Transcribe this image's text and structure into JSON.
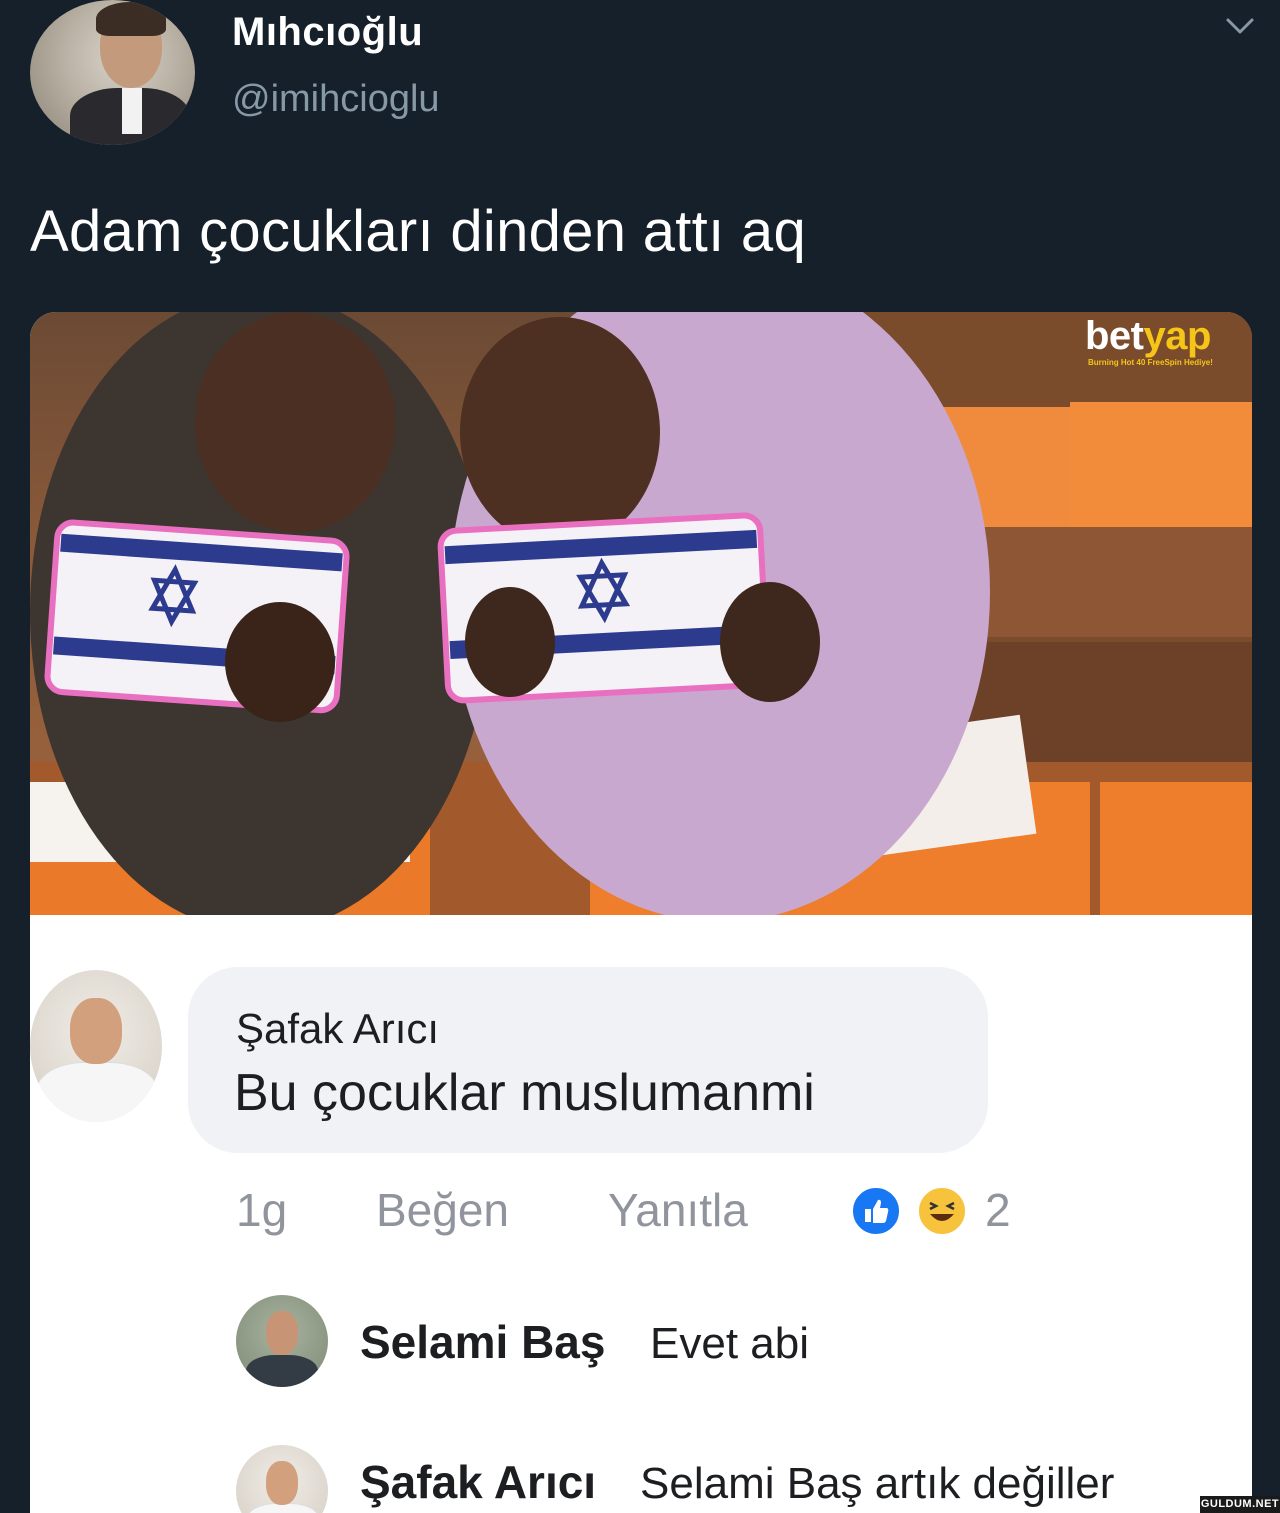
{
  "tweet": {
    "author_name": "Mıhcıoğlu",
    "author_handle": "@imihcioglu",
    "text": "Adam çocukları dinden attı aq"
  },
  "media": {
    "watermark": {
      "brand": "bet",
      "brand_accent": "yap",
      "tagline": "Burning Hot 40 FreeSpin Hediye!"
    },
    "comment": {
      "author": "Şafak Arıcı",
      "text": "Bu çocuklar muslumanmi",
      "time": "1g",
      "like_label": "Beğen",
      "reply_label": "Yanıtla",
      "reaction_icons": [
        "like-icon",
        "haha-icon"
      ],
      "reaction_count": "2"
    },
    "replies": [
      {
        "author": "Selami Baş",
        "text": "Evet abi"
      },
      {
        "author": "Şafak Arıcı",
        "text": "Selami Baş  artık değiller"
      }
    ]
  },
  "site_watermark": "GULDUM.NET",
  "colors": {
    "background": "#15202b",
    "handle": "#8899a6",
    "like_blue": "#1877f2",
    "haha_yellow": "#f7c23c"
  }
}
